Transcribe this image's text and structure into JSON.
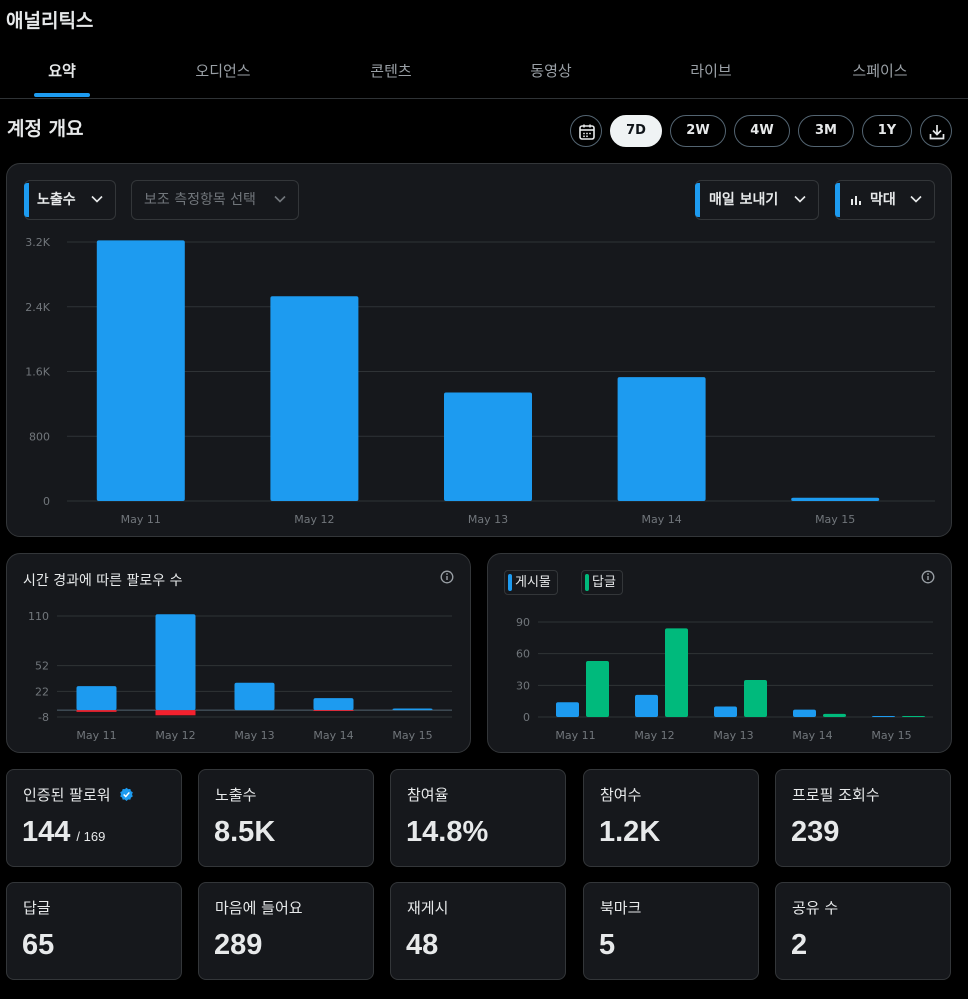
{
  "app": {
    "title": "애널리틱스"
  },
  "tabs": [
    {
      "label": "요약",
      "active": true
    },
    {
      "label": "오디언스",
      "active": false
    },
    {
      "label": "콘텐츠",
      "active": false
    },
    {
      "label": "동영상",
      "active": false
    },
    {
      "label": "라이브",
      "active": false
    },
    {
      "label": "스페이스",
      "active": false
    }
  ],
  "overview": {
    "title": "계정 개요",
    "ranges": [
      "7D",
      "2W",
      "4W",
      "3M",
      "1Y"
    ],
    "selected_range": "7D"
  },
  "main_chart": {
    "metric_dropdown": "노출수",
    "secondary_dropdown": "보조 측정항목 선택",
    "interval_dropdown": "매일 보내기",
    "type_dropdown": "막대"
  },
  "followers_chart": {
    "title": "시간 경과에 따른 팔로우 수"
  },
  "posts_chart": {
    "legend": [
      "게시물",
      "답글"
    ]
  },
  "metrics_row1": [
    {
      "label": "인증된 팔로워",
      "value": "144",
      "sub": "/ 169",
      "verified": true
    },
    {
      "label": "노출수",
      "value": "8.5K"
    },
    {
      "label": "참여율",
      "value": "14.8%"
    },
    {
      "label": "참여수",
      "value": "1.2K"
    },
    {
      "label": "프로필 조회수",
      "value": "239"
    }
  ],
  "metrics_row2": [
    {
      "label": "답글",
      "value": "65"
    },
    {
      "label": "마음에 들어요",
      "value": "289"
    },
    {
      "label": "재게시",
      "value": "48"
    },
    {
      "label": "북마크",
      "value": "5"
    },
    {
      "label": "공유 수",
      "value": "2"
    }
  ],
  "colors": {
    "accent": "#1d9bf0",
    "reply": "#00ba7c",
    "unfollow": "#f4212e",
    "panel": "#16181c",
    "border": "#333639"
  },
  "chart_data": [
    {
      "type": "bar",
      "categories": [
        "May 11",
        "May 12",
        "May 13",
        "May 14",
        "May 15"
      ],
      "yticks": [
        0,
        800,
        1600,
        2400,
        3200
      ],
      "ytick_labels": [
        "0",
        "800",
        "1.6K",
        "2.4K",
        "3.2K"
      ],
      "ylim": [
        0,
        3200
      ],
      "series": [
        {
          "name": "노출수",
          "values": [
            3220,
            2530,
            1340,
            1530,
            40
          ]
        }
      ],
      "grid": true
    },
    {
      "type": "bar",
      "title": "시간 경과에 따른 팔로우 수",
      "categories": [
        "May 11",
        "May 12",
        "May 13",
        "May 14",
        "May 15"
      ],
      "yticks": [
        -8,
        22,
        52,
        110
      ],
      "ylim": [
        -8,
        110
      ],
      "series": [
        {
          "values": [
            28,
            112,
            32,
            14,
            2
          ]
        },
        {
          "values": [
            -2,
            -6,
            0,
            -1,
            0
          ]
        }
      ],
      "grid": true
    },
    {
      "type": "bar",
      "categories": [
        "May 11",
        "May 12",
        "May 13",
        "May 14",
        "May 15"
      ],
      "yticks": [
        0,
        30,
        60,
        90
      ],
      "ylim": [
        0,
        90
      ],
      "series": [
        {
          "name": "게시물",
          "values": [
            14,
            21,
            10,
            7,
            1
          ]
        },
        {
          "name": "답글",
          "values": [
            53,
            84,
            35,
            3,
            1
          ]
        }
      ],
      "legend": "top-left",
      "grid": true
    }
  ]
}
